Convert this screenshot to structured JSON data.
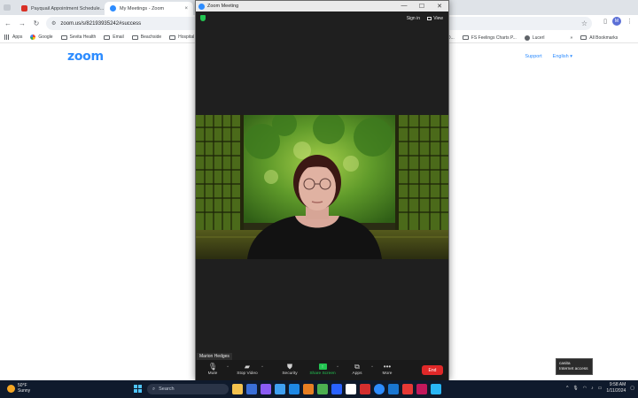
{
  "browser": {
    "tabs": [
      {
        "title": "Payquail Appointment Schedule...",
        "close": "×",
        "active": false
      },
      {
        "title": "My Meetings - Zoom",
        "close": "×",
        "active": true
      }
    ],
    "nav": {
      "back": "←",
      "forward": "→",
      "reload": "↻"
    },
    "url": "zoom.us/s/82193935242#success",
    "profile_initial": "M",
    "bookmarks": [
      {
        "label": "Apps",
        "icon": "apps-grid-icon"
      },
      {
        "label": "Google",
        "icon": "google-icon"
      },
      {
        "label": "Sevita Health",
        "icon": "folder-icon"
      },
      {
        "label": "Email",
        "icon": "folder-icon"
      },
      {
        "label": "Beachside",
        "icon": "folder-icon"
      },
      {
        "label": "Hospital",
        "icon": "folder-icon"
      }
    ],
    "bookmarks_right": [
      {
        "label": "D...",
        "icon": "folder-icon"
      },
      {
        "label": "FS Feelings Charts P...",
        "icon": "folder-icon"
      },
      {
        "label": "Lucerl",
        "icon": "site-icon"
      }
    ],
    "bookmarks_more": "»",
    "all_bookmarks": "All Bookmarks"
  },
  "page": {
    "logo": "zoom",
    "links": [
      "Support",
      "English ▾"
    ]
  },
  "zoom_window": {
    "title": "Zoom Meeting",
    "window_controls": [
      "—",
      "☐",
      "✕"
    ],
    "sign_in": "Sign in",
    "view": "View",
    "participant_name": "Marion Hedges",
    "controls": [
      {
        "label": "Mute",
        "icon": "microphone-icon"
      },
      {
        "label": "Stop Video",
        "icon": "video-camera-icon"
      },
      {
        "label": "Security",
        "icon": "shield-icon"
      },
      {
        "label": "Share Screen",
        "icon": "share-screen-icon"
      },
      {
        "label": "Apps",
        "icon": "apps-icon"
      },
      {
        "label": "More",
        "icon": "more-dots-icon"
      }
    ],
    "end": "End",
    "colors": {
      "accent": "#2d8cff",
      "share": "#23c552",
      "end": "#e02828"
    }
  },
  "tooltip": {
    "line1": "casita",
    "line2": "Internet access"
  },
  "taskbar": {
    "weather_temp": "50°F",
    "weather_cond": "Sunny",
    "search_placeholder": "Search",
    "time": "9:58 AM",
    "date": "1/11/2024"
  }
}
